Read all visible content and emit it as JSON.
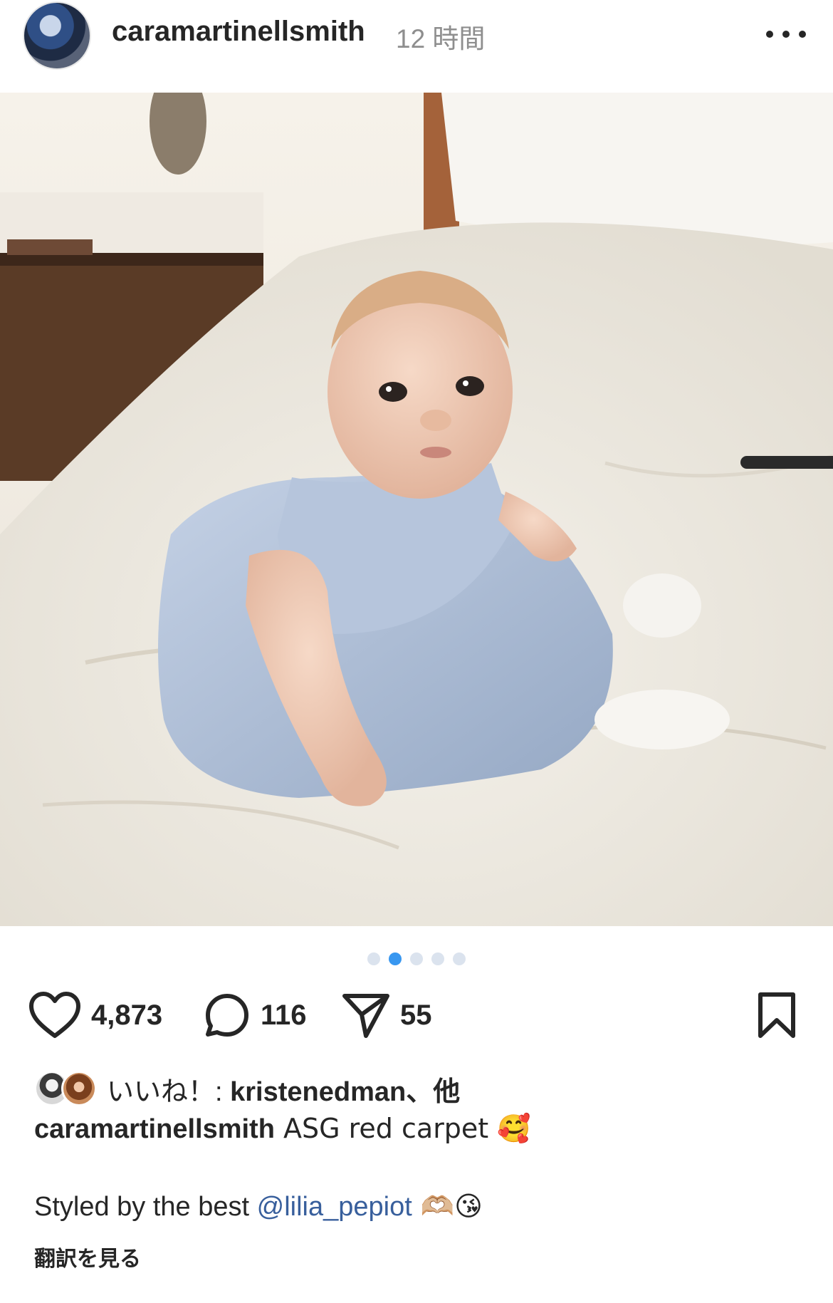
{
  "post": {
    "username": "caramartinellsmith",
    "time_ago": "12 時間",
    "more_icon": "more-horizontal-icon"
  },
  "carousel": {
    "count": 5,
    "active_index": 1
  },
  "actions": {
    "like_count": "4,873",
    "comment_count": "116",
    "share_count": "55"
  },
  "likes": {
    "prefix": "いいね！: ",
    "liker": "kristenedman",
    "suffix": "、他"
  },
  "caption": {
    "username": "caramartinellsmith",
    "text": " ASG red carpet 🥰",
    "line2_text": "Styled by the best ",
    "line2_mention": "@lilia_pepiot",
    "line2_emoji": " 🫶🏼😘"
  },
  "translate_label": "翻訳を見る",
  "colors": {
    "accent": "#3897f0",
    "mention": "#385f9c",
    "text": "#262626",
    "muted": "#8e8e8e"
  }
}
